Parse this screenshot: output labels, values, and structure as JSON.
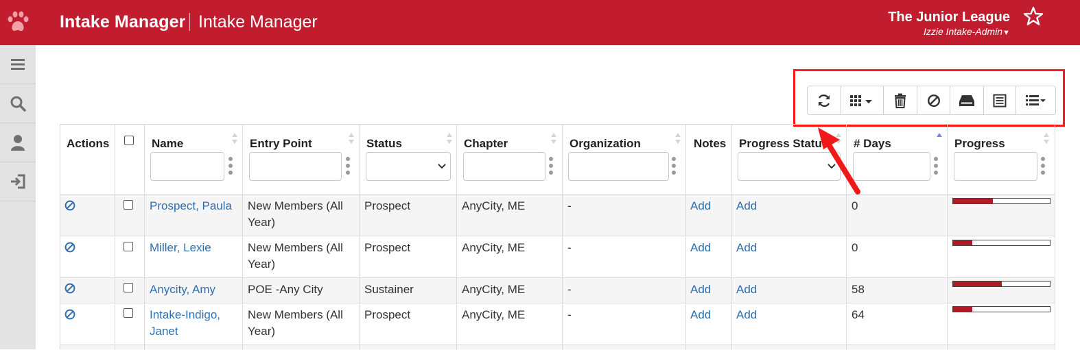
{
  "header": {
    "app_title": "Intake Manager",
    "page_title": "Intake Manager",
    "org_name": "The Junior League",
    "user_name": "Izzie Intake-Admin",
    "logo_icon": "paw-icon",
    "favorite_icon": "star-icon",
    "brand_color": "#c11d2e"
  },
  "sidebar": {
    "items": [
      {
        "icon": "menu-icon"
      },
      {
        "icon": "search-icon"
      },
      {
        "icon": "user-icon"
      },
      {
        "icon": "logout-icon"
      }
    ]
  },
  "toolbar": {
    "buttons": [
      {
        "icon": "refresh-icon"
      },
      {
        "icon": "grid-columns-icon"
      },
      {
        "icon": "trash-icon"
      },
      {
        "icon": "block-icon"
      },
      {
        "icon": "inbox-icon"
      },
      {
        "icon": "report-icon"
      },
      {
        "icon": "list-view-icon"
      }
    ]
  },
  "table": {
    "columns": {
      "actions": "Actions",
      "name": "Name",
      "entry_point": "Entry Point",
      "status": "Status",
      "chapter": "Chapter",
      "organization": "Organization",
      "notes": "Notes",
      "progress_status": "Progress Status",
      "days": "# Days",
      "progress": "Progress"
    },
    "rows": [
      {
        "name": "Prospect, Paula",
        "entry_point": "New Members (All Year)",
        "status": "Prospect",
        "chapter": "AnyCity, ME",
        "organization": "-",
        "notes": "Add",
        "progress_status": "Add",
        "days": "0",
        "progress": 0.41
      },
      {
        "name": "Miller, Lexie",
        "entry_point": "New Members (All Year)",
        "status": "Prospect",
        "chapter": "AnyCity, ME",
        "organization": "-",
        "notes": "Add",
        "progress_status": "Add",
        "days": "0",
        "progress": 0.2
      },
      {
        "name": "Anycity, Amy",
        "entry_point": "POE -Any City",
        "status": "Sustainer",
        "chapter": "AnyCity, ME",
        "organization": "-",
        "notes": "Add",
        "progress_status": "Add",
        "days": "58",
        "progress": 0.5
      },
      {
        "name": "Intake-Indigo, Janet",
        "entry_point": "New Members (All Year)",
        "status": "Prospect",
        "chapter": "AnyCity, ME",
        "organization": "-",
        "notes": "Add",
        "progress_status": "Add",
        "days": "64",
        "progress": 0.2
      }
    ]
  }
}
